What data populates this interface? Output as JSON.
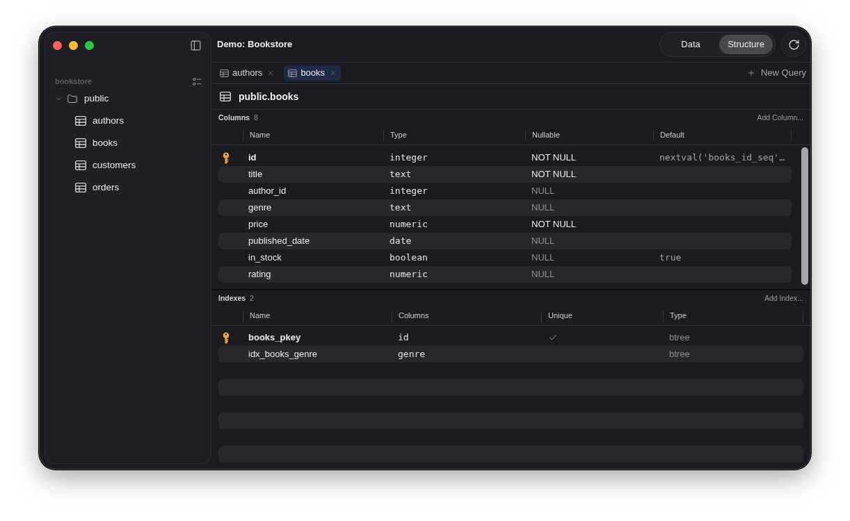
{
  "window": {
    "title": "Demo: Bookstore"
  },
  "sidebar": {
    "database": "bookstore",
    "tree": [
      {
        "label": "public",
        "expanded": true,
        "children": [
          {
            "label": "authors"
          },
          {
            "label": "books"
          },
          {
            "label": "customers"
          },
          {
            "label": "orders"
          }
        ]
      }
    ]
  },
  "view_switch": [
    {
      "label": "Data",
      "selected": false
    },
    {
      "label": "Structure",
      "selected": true
    }
  ],
  "tabs": [
    {
      "label": "authors",
      "selected": false
    },
    {
      "label": "books",
      "selected": true
    }
  ],
  "new_query": "New Query",
  "table_title": "public.books",
  "columns_section": {
    "title": "Columns",
    "count": "8",
    "action": "Add Column...",
    "headers": [
      "Name",
      "Type",
      "Nullable",
      "Default"
    ],
    "rows": [
      {
        "name": "id",
        "type": "integer",
        "nullable": "NOT NULL",
        "not_null": true,
        "default": "nextval('books_id_seq'…",
        "primary_key": true
      },
      {
        "name": "title",
        "type": "text",
        "nullable": "NOT NULL",
        "not_null": true,
        "primary_key": false
      },
      {
        "name": "author_id",
        "type": "integer",
        "nullable": "NULL",
        "not_null": false,
        "primary_key": false
      },
      {
        "name": "genre",
        "type": "text",
        "nullable": "NULL",
        "not_null": false,
        "primary_key": false
      },
      {
        "name": "price",
        "type": "numeric",
        "nullable": "NOT NULL",
        "not_null": true,
        "primary_key": false
      },
      {
        "name": "published_date",
        "type": "date",
        "nullable": "NULL",
        "not_null": false,
        "primary_key": false
      },
      {
        "name": "in_stock",
        "type": "boolean",
        "nullable": "NULL",
        "not_null": false,
        "default": "true",
        "primary_key": false
      },
      {
        "name": "rating",
        "type": "numeric",
        "nullable": "NULL",
        "not_null": false,
        "primary_key": false
      }
    ]
  },
  "indexes_section": {
    "title": "Indexes",
    "count": "2",
    "action": "Add Index...",
    "headers": [
      "Name",
      "Columns",
      "Unique",
      "Type"
    ],
    "rows": [
      {
        "name": "books_pkey",
        "columns": "id",
        "unique": true,
        "type": "btree",
        "primary_key": true
      },
      {
        "name": "idx_books_genre",
        "columns": "genre",
        "unique": false,
        "type": "btree",
        "primary_key": false
      }
    ]
  }
}
